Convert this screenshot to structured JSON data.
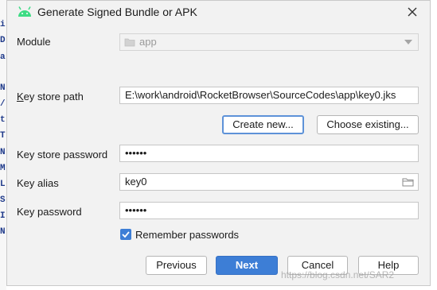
{
  "background_code_letters": [
    "i",
    "D",
    "a",
    "N",
    "/",
    "t",
    "T",
    "N",
    "M",
    "L",
    "S",
    "I",
    "N"
  ],
  "dialog": {
    "title": "Generate Signed Bundle or APK",
    "module": {
      "label": "Module",
      "value": "app"
    },
    "key_store_path": {
      "label": "Key store path",
      "value": "E:\\work\\android\\RocketBrowser\\SourceCodes\\app\\key0.jks"
    },
    "create_new_label": "Create new...",
    "choose_existing_label": "Choose existing...",
    "key_store_password": {
      "label": "Key store password",
      "value": "••••••"
    },
    "key_alias": {
      "label": "Key alias",
      "value": "key0"
    },
    "key_password": {
      "label": "Key password",
      "value": "••••••"
    },
    "remember_passwords": {
      "label": "Remember passwords",
      "checked": true
    },
    "buttons": {
      "previous": "Previous",
      "next": "Next",
      "cancel": "Cancel",
      "help": "Help"
    }
  },
  "watermark": "https://blog.csdn.net/SAR2",
  "colors": {
    "accent": "#3d7ed6",
    "android_green": "#3ddc84",
    "dialog_bg": "#f2f2f2"
  }
}
